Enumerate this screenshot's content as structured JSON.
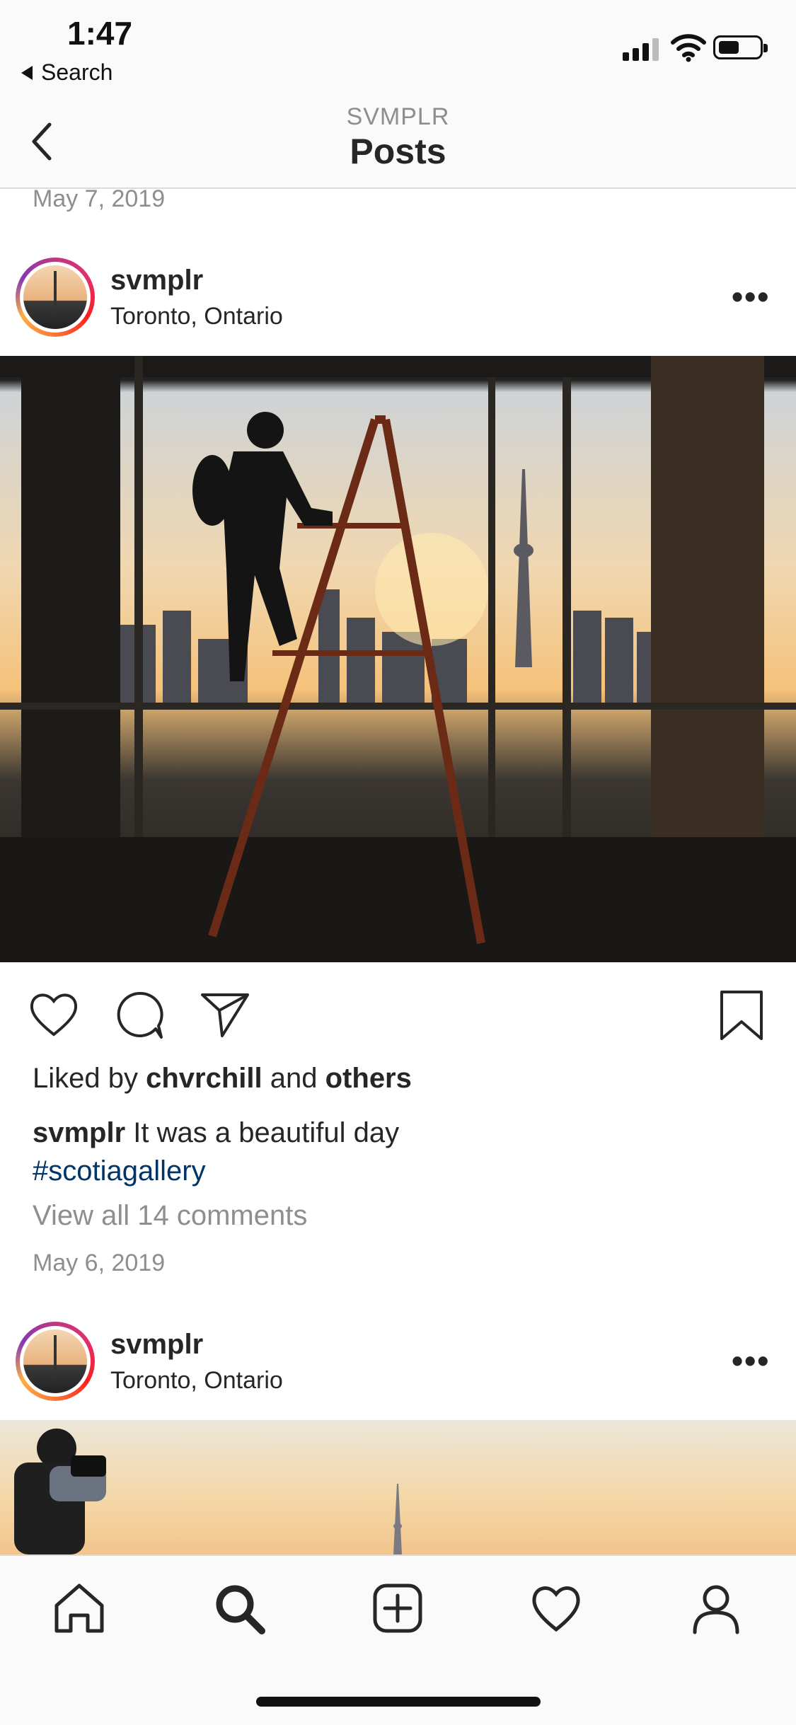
{
  "status": {
    "time": "1:47",
    "back_app": "Search"
  },
  "header": {
    "subtitle": "SVMPLR",
    "title": "Posts"
  },
  "previous_post": {
    "date": "May 7, 2019"
  },
  "post1": {
    "username": "svmplr",
    "location": "Toronto, Ontario",
    "likes": {
      "prefix": "Liked by",
      "user": "chvrchill",
      "middle": "and",
      "others": "others"
    },
    "caption": {
      "user": "svmplr",
      "text": "It was a beautiful day",
      "hashtag": "#scotiagallery"
    },
    "comments_link": "View all 14 comments",
    "date": "May 6, 2019"
  },
  "post2": {
    "username": "svmplr",
    "location": "Toronto, Ontario"
  },
  "tabbar": {
    "icons": [
      "home-icon",
      "search-icon",
      "add-post-icon",
      "activity-heart-icon",
      "profile-icon"
    ]
  },
  "colors": {
    "hashtag": "#003569",
    "muted": "#8e8e8e",
    "text": "#262626"
  }
}
